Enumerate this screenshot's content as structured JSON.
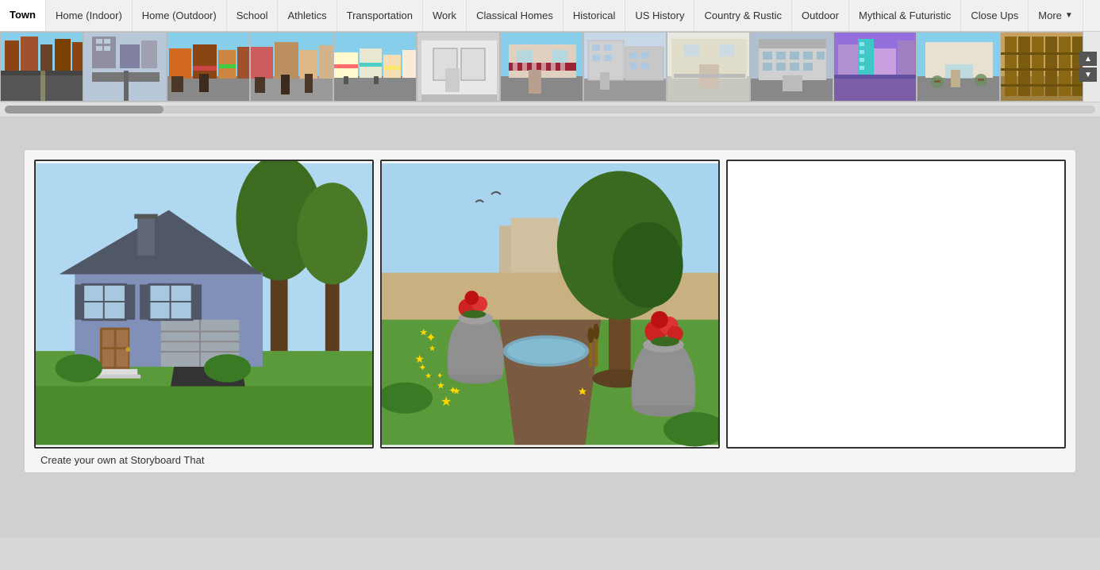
{
  "nav": {
    "items": [
      {
        "id": "town",
        "label": "Town",
        "active": true
      },
      {
        "id": "home-indoor",
        "label": "Home (Indoor)",
        "active": false
      },
      {
        "id": "home-outdoor",
        "label": "Home (Outdoor)",
        "active": false
      },
      {
        "id": "school",
        "label": "School",
        "active": false
      },
      {
        "id": "athletics",
        "label": "Athletics",
        "active": false
      },
      {
        "id": "transportation",
        "label": "Transportation",
        "active": false
      },
      {
        "id": "work",
        "label": "Work",
        "active": false
      },
      {
        "id": "classical-homes",
        "label": "Classical Homes",
        "active": false
      },
      {
        "id": "historical",
        "label": "Historical",
        "active": false
      },
      {
        "id": "us-history",
        "label": "US History",
        "active": false
      },
      {
        "id": "country-rustic",
        "label": "Country & Rustic",
        "active": false
      },
      {
        "id": "outdoor",
        "label": "Outdoor",
        "active": false
      },
      {
        "id": "mythical-futuristic",
        "label": "Mythical & Futuristic",
        "active": false
      },
      {
        "id": "close-ups",
        "label": "Close Ups",
        "active": false
      },
      {
        "id": "more",
        "label": "More",
        "active": false,
        "hasDropdown": true
      }
    ]
  },
  "thumbnails": [
    {
      "id": "t1",
      "alt": "Town street 1"
    },
    {
      "id": "t2",
      "alt": "Town aerial"
    },
    {
      "id": "t3",
      "alt": "Town street 2"
    },
    {
      "id": "t4",
      "alt": "Town block"
    },
    {
      "id": "t5",
      "alt": "Town shops"
    },
    {
      "id": "t6",
      "alt": "Town store"
    },
    {
      "id": "t7",
      "alt": "Town buildings"
    },
    {
      "id": "t8",
      "alt": "Town street 3"
    },
    {
      "id": "t9",
      "alt": "Town exterior"
    },
    {
      "id": "t10",
      "alt": "Town modern"
    },
    {
      "id": "t11",
      "alt": "Town colorful"
    },
    {
      "id": "t12",
      "alt": "Town restaurant"
    },
    {
      "id": "t13",
      "alt": "Town shelves"
    }
  ],
  "controls": {
    "scroll_up": "▲",
    "scroll_down": "▼"
  },
  "storyboard": {
    "cells": [
      {
        "id": "cell1",
        "type": "house-scene"
      },
      {
        "id": "cell2",
        "type": "garden-scene"
      },
      {
        "id": "cell3",
        "type": "empty"
      }
    ],
    "watermark": "Create your own at Storyboard That"
  }
}
